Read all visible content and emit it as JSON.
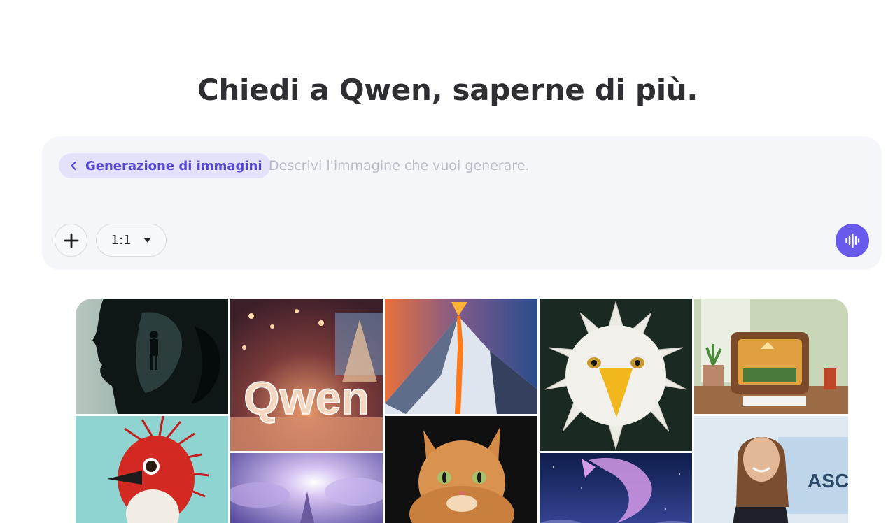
{
  "header": {
    "title": "Chiedi a Qwen, saperne di più."
  },
  "composer": {
    "mode_chip_label": "Generazione di immagini",
    "placeholder": "Descrivi l'immagine che vuoi generare.",
    "value": "",
    "aspect_ratio": "1:1",
    "icons": {
      "back": "chevron-left-icon",
      "attach": "plus-icon",
      "ratio_dropdown": "caret-down-icon",
      "voice": "voice-waveform-icon"
    }
  },
  "colors": {
    "accent": "#6659ec",
    "chip_bg": "#e4e1fb",
    "chip_text": "#5548d9",
    "card_bg": "#f5f6fa",
    "placeholder": "#b9bcc8"
  },
  "gallery": {
    "tiles": [
      {
        "subject": "woman silhouette with figure in forest"
      },
      {
        "subject": "glittering Qwen letters",
        "text": "Qwen"
      },
      {
        "subject": "erupting snowy volcano"
      },
      {
        "subject": "white feathered eagle head"
      },
      {
        "subject": "miniature room inside vintage radio"
      },
      {
        "subject": "red spiky bird"
      },
      {
        "subject": "purple sky with castle"
      },
      {
        "subject": "orange tabby cat"
      },
      {
        "subject": "glowing purple whale in night sky"
      },
      {
        "subject": "smiling woman speaking on stage",
        "text": "ASC"
      }
    ]
  }
}
